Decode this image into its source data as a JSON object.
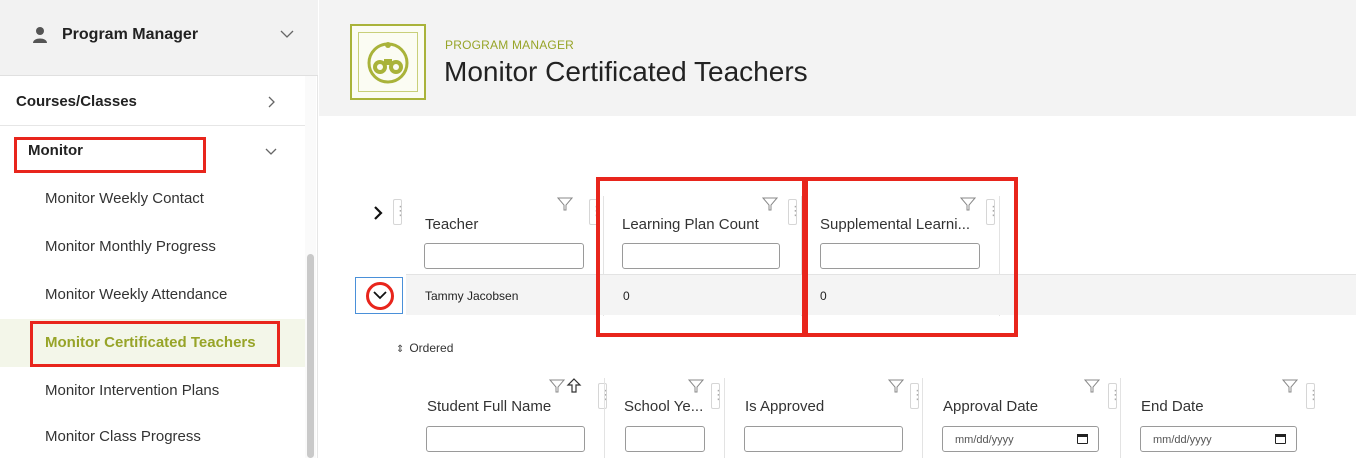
{
  "sidebar": {
    "header_title": "Program Manager",
    "items": {
      "courses": "Courses/Classes",
      "monitor": "Monitor"
    },
    "monitor_children": [
      "Monitor Weekly Contact",
      "Monitor Monthly Progress",
      "Monitor Weekly Attendance",
      "Monitor Certificated Teachers",
      "Monitor Intervention Plans",
      "Monitor Class Progress"
    ],
    "active_item": "Monitor Certificated Teachers"
  },
  "header": {
    "kicker": "PROGRAM MANAGER",
    "title": "Monitor Certificated Teachers"
  },
  "grid": {
    "columns": [
      "Teacher",
      "Learning Plan Count",
      "Supplemental Learni..."
    ],
    "rows": [
      {
        "teacher": "Tammy Jacobsen",
        "learning_plan_count": "0",
        "supplemental": "0"
      }
    ]
  },
  "detail": {
    "ordered_label": "Ordered",
    "columns": [
      "Student Full Name",
      "School Ye...",
      "Is Approved",
      "Approval Date",
      "End Date"
    ],
    "date_placeholder": "mm/dd/yyyy"
  },
  "colors": {
    "accent": "#97a428",
    "highlight_box": "#e8251c",
    "focus_border": "#4a90d9"
  }
}
